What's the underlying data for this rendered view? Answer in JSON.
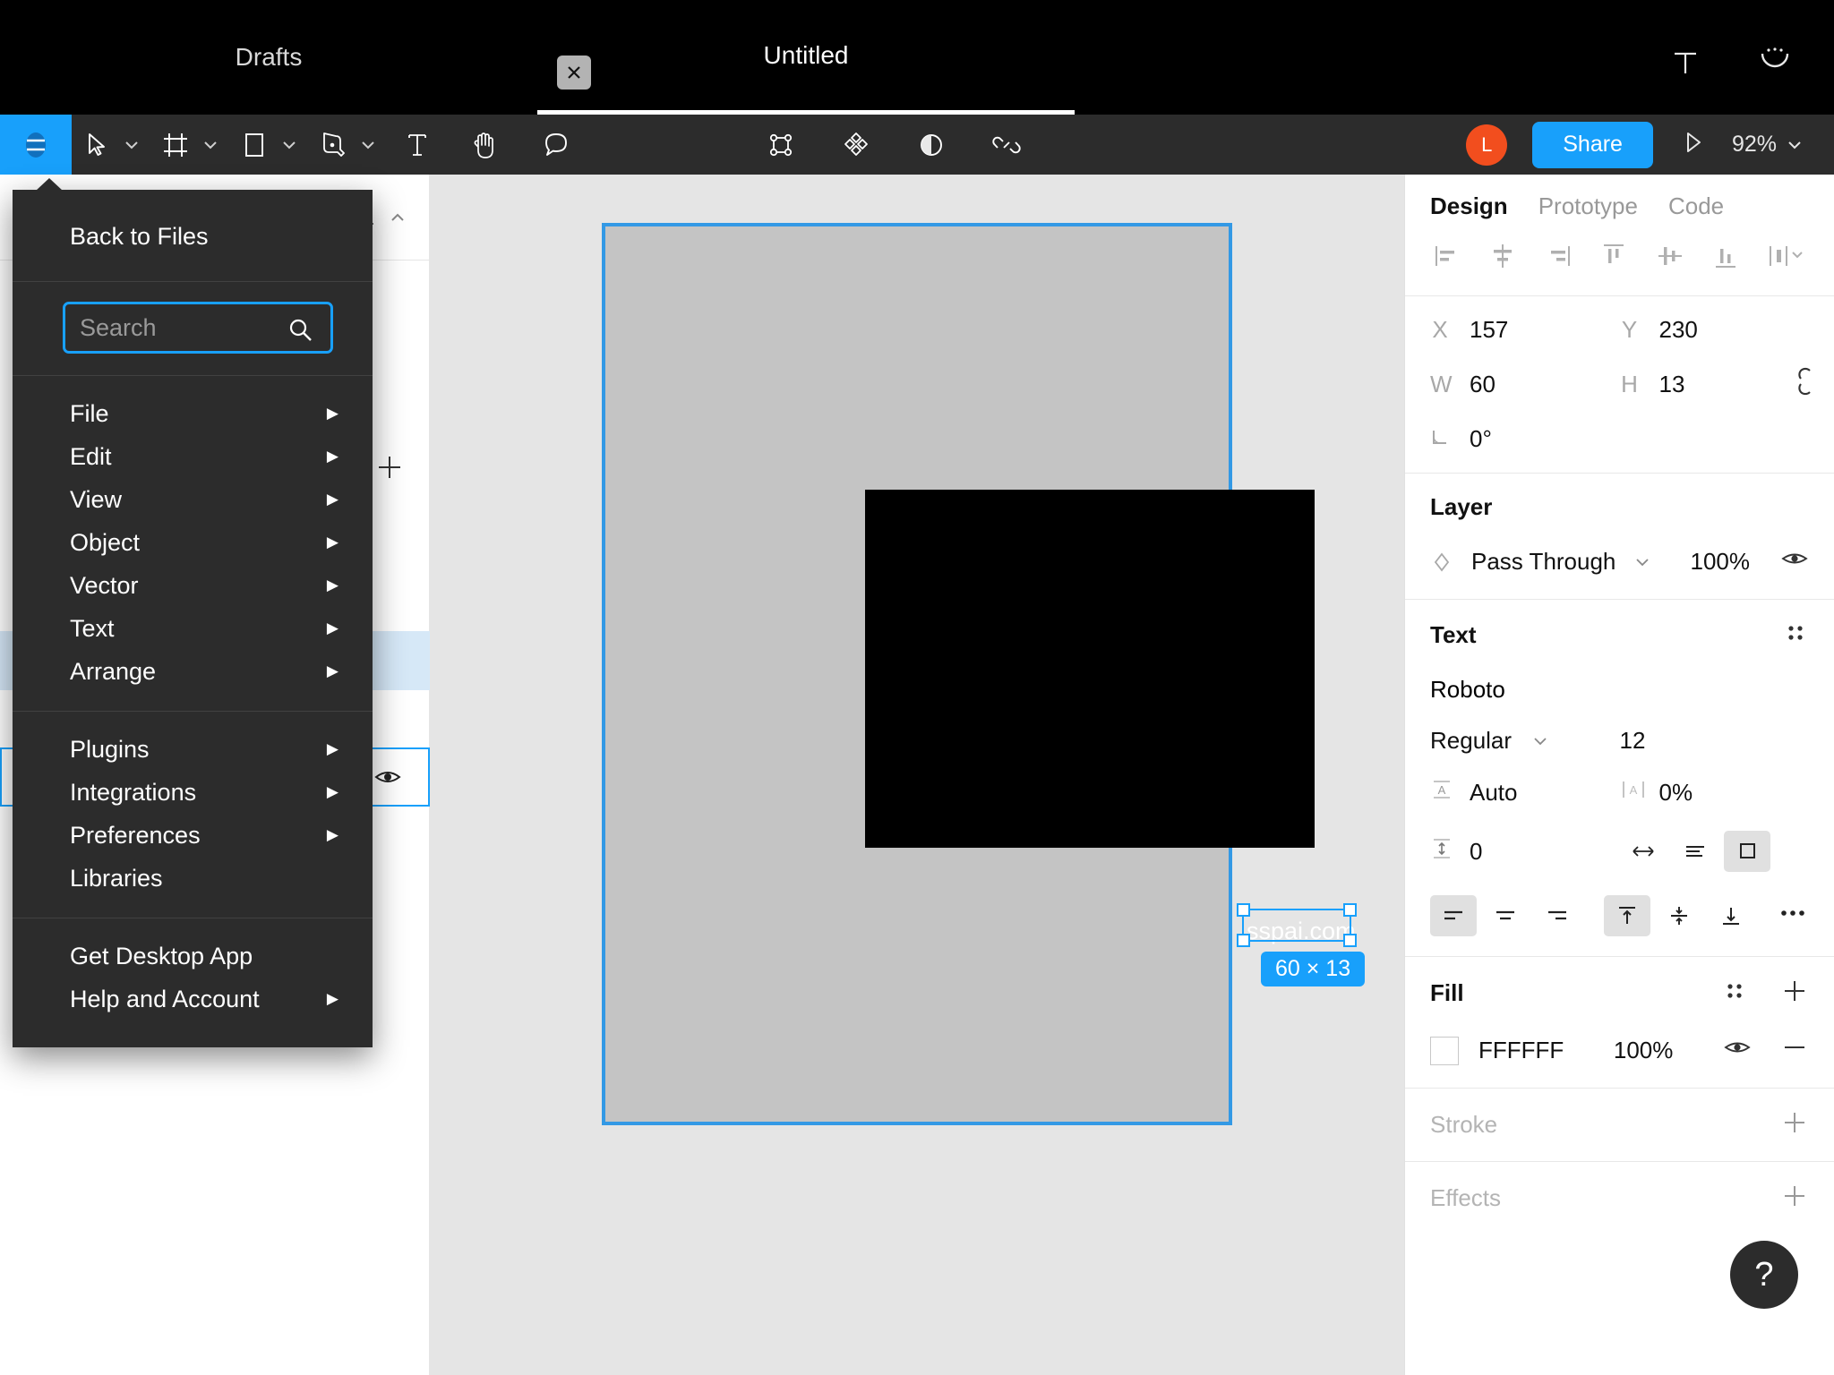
{
  "titlebar": {
    "tabs": [
      {
        "label": "Drafts",
        "active": false
      },
      {
        "label": "Untitled",
        "active": true
      }
    ],
    "close_label": "×",
    "actions": [
      "text-icon",
      "more-options-icon"
    ]
  },
  "toolbar": {
    "menu_icon": "figma-menu-icon",
    "tools": [
      {
        "name": "move-tool",
        "icon": "cursor-icon",
        "has_caret": true
      },
      {
        "name": "frame-tool",
        "icon": "frame-icon",
        "has_caret": true
      },
      {
        "name": "shape-tool",
        "icon": "rectangle-icon",
        "has_caret": true
      },
      {
        "name": "pen-tool",
        "icon": "pen-icon",
        "has_caret": true
      },
      {
        "name": "text-tool",
        "icon": "text-t-icon",
        "has_caret": false
      },
      {
        "name": "hand-tool",
        "icon": "hand-icon",
        "has_caret": false
      },
      {
        "name": "comment-tool",
        "icon": "comment-bubble-icon",
        "has_caret": false
      }
    ],
    "center_tools": [
      {
        "name": "create-component",
        "icon": "component-icon"
      },
      {
        "name": "components-library",
        "icon": "diamonds-icon"
      },
      {
        "name": "mask-tool",
        "icon": "contrast-circle-icon"
      },
      {
        "name": "link-tool",
        "icon": "link-icon"
      }
    ],
    "avatar_initial": "L",
    "share_label": "Share",
    "present_icon": "play-triangle-icon",
    "zoom_label": "92%"
  },
  "menu": {
    "back_label": "Back to Files",
    "search_placeholder": "Search",
    "search_value": "",
    "search_icon": "search-icon",
    "groups": [
      {
        "items": [
          {
            "label": "File",
            "submenu": true
          },
          {
            "label": "Edit",
            "submenu": true
          },
          {
            "label": "View",
            "submenu": true
          },
          {
            "label": "Object",
            "submenu": true
          },
          {
            "label": "Vector",
            "submenu": true
          },
          {
            "label": "Text",
            "submenu": true
          },
          {
            "label": "Arrange",
            "submenu": true
          }
        ]
      },
      {
        "items": [
          {
            "label": "Plugins",
            "submenu": true
          },
          {
            "label": "Integrations",
            "submenu": true
          },
          {
            "label": "Preferences",
            "submenu": true
          },
          {
            "label": "Libraries",
            "submenu": false
          }
        ]
      },
      {
        "items": [
          {
            "label": "Get Desktop App",
            "submenu": false
          },
          {
            "label": "Help and Account",
            "submenu": true
          }
        ]
      }
    ],
    "arrow_glyph": "▶"
  },
  "left_panel": {
    "page_count": "1",
    "collapse_icon": "chevron-up-icon",
    "add_icon": "plus-icon",
    "visibility_icon": "eye-icon"
  },
  "canvas": {
    "frame_fill": "#c4c4c4",
    "rect_fill": "#000000",
    "background": "#e5e5e5",
    "selection_color": "#18a0fb",
    "selected_text": "sspai.com",
    "size_badge": "60 × 13"
  },
  "right_panel": {
    "tabs": [
      {
        "label": "Design",
        "active": true
      },
      {
        "label": "Prototype",
        "active": false
      },
      {
        "label": "Code",
        "active": false
      }
    ],
    "align_icons": [
      "align-left-icon",
      "align-horizontal-center-icon",
      "align-right-icon",
      "align-top-icon",
      "align-vertical-center-icon",
      "align-bottom-icon",
      "distribute-icon"
    ],
    "transform": {
      "x_label": "X",
      "x_value": "157",
      "y_label": "Y",
      "y_value": "230",
      "w_label": "W",
      "w_value": "60",
      "h_label": "H",
      "h_value": "13",
      "rotation_label": "angle-icon",
      "rotation_value": "0°",
      "constrain_icon": "link-broken-icon"
    },
    "layer": {
      "title": "Layer",
      "blend_mode": "Pass Through",
      "opacity": "100%",
      "visibility_icon": "eye-icon",
      "blend_icon": "blend-drop-icon"
    },
    "text": {
      "title": "Text",
      "settings_icon": "four-dots-icon",
      "font_family": "Roboto",
      "font_style": "Regular",
      "font_size": "12",
      "line_height_icon": "line-height-icon",
      "line_height": "Auto",
      "letter_spacing_icon": "letter-spacing-icon",
      "letter_spacing": "0%",
      "paragraph_spacing_icon": "paragraph-spacing-icon",
      "paragraph_spacing": "0",
      "resize_modes": [
        "auto-width-icon",
        "auto-height-icon",
        "fixed-size-icon"
      ],
      "resize_active": 2,
      "h_align": [
        "align-text-left-icon",
        "align-text-center-icon",
        "align-text-right-icon"
      ],
      "h_align_active": 0,
      "v_align": [
        "align-text-top-icon",
        "align-text-middle-icon",
        "align-text-bottom-icon"
      ],
      "v_align_active": 0,
      "more_icon": "ellipsis-icon"
    },
    "fill": {
      "title": "Fill",
      "settings_icon": "four-dots-icon",
      "add_icon": "plus-icon",
      "color_hex": "FFFFFF",
      "opacity": "100%",
      "visibility_icon": "eye-icon",
      "remove_icon": "minus-icon"
    },
    "stroke": {
      "title": "Stroke",
      "add_icon": "plus-icon"
    },
    "effects": {
      "title": "Effects",
      "add_icon": "plus-icon"
    },
    "help_label": "?"
  }
}
